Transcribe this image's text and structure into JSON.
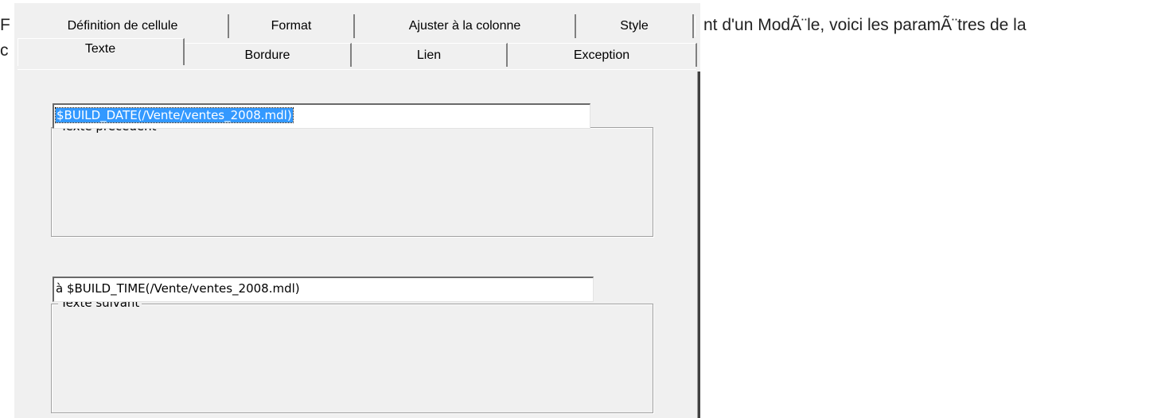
{
  "background_text": {
    "line1_start": "F",
    "line2_start": "c",
    "right_fragment": "nt d'un ModÃ¨le, voici les paramÃ¨tres de la"
  },
  "tabs_top": [
    {
      "label": "Définition de cellule"
    },
    {
      "label": "Format"
    },
    {
      "label": "Ajuster à la colonne"
    },
    {
      "label": "Style"
    }
  ],
  "tabs_bottom": [
    {
      "label": "Texte",
      "active": true
    },
    {
      "label": "Bordure"
    },
    {
      "label": "Lien"
    },
    {
      "label": "Exception"
    }
  ],
  "groups": {
    "preceding": {
      "legend": "Texte précédent",
      "value": "$BUILD_DATE(/Vente/ventes_2008.mdl)"
    },
    "following": {
      "legend": "Texte suivant",
      "value": "à $BUILD_TIME(/Vente/ventes_2008.mdl)"
    }
  },
  "colors": {
    "dialog_bg": "#f0f0f0",
    "selection": "#3399ff"
  }
}
